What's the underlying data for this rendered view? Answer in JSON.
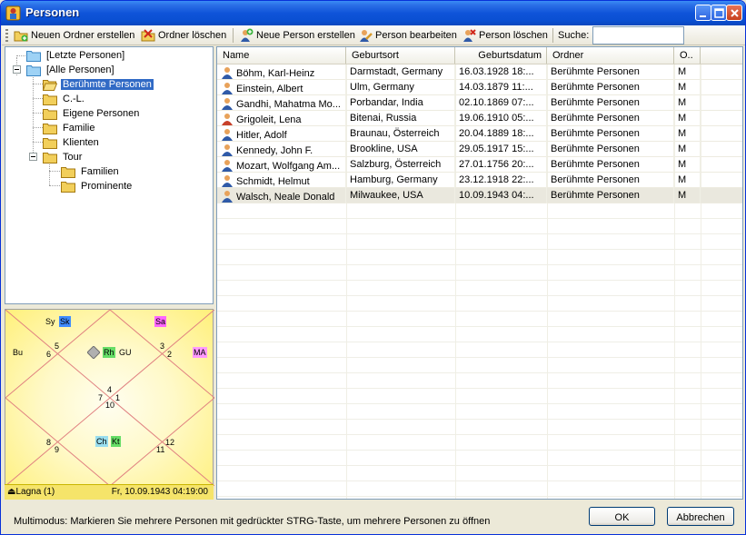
{
  "window": {
    "title": "Personen"
  },
  "toolbar": {
    "new_folder": "Neuen Ordner erstellen",
    "delete_folder": "Ordner löschen",
    "new_person": "Neue Person erstellen",
    "edit_person": "Person bearbeiten",
    "delete_person": "Person löschen",
    "search_label": "Suche:",
    "search_value": ""
  },
  "tree": {
    "items": [
      {
        "label": "[Letzte Personen]"
      },
      {
        "label": "[Alle Personen]"
      },
      {
        "label": "Berühmte Personen"
      },
      {
        "label": "C.-L."
      },
      {
        "label": "Eigene Personen"
      },
      {
        "label": "Familie"
      },
      {
        "label": "Klienten"
      },
      {
        "label": "Tour"
      },
      {
        "label": "Familien"
      },
      {
        "label": "Prominente"
      }
    ]
  },
  "chart": {
    "planets": {
      "sy": "Sy",
      "sk": "Sk",
      "sa": "Sa",
      "bu": "Bu",
      "ma": "MA",
      "rh": "Rh",
      "gu": "GU",
      "ch": "Ch",
      "kt": "Kt"
    },
    "houses": [
      "1",
      "2",
      "3",
      "4",
      "5",
      "6",
      "7",
      "8",
      "9",
      "10",
      "11",
      "12"
    ],
    "footer_left": "Lagna (1)",
    "footer_right": "Fr, 10.09.1943 04:19:00",
    "colors": {
      "sk": "#3f8cff",
      "sa": "#ff66ff",
      "ma": "#ff99ff",
      "rh": "#66dd66",
      "ch": "#99ddee",
      "kt": "#66dd66"
    }
  },
  "list": {
    "columns": [
      "Name",
      "Geburtsort",
      "Geburtsdatum",
      "Ordner",
      "O.."
    ],
    "rows": [
      {
        "name": "Böhm, Karl-Heinz",
        "place": "Darmstadt, Germany",
        "date": "16.03.1928 18:...",
        "folder": "Berühmte Personen",
        "o": "M",
        "gender": "m"
      },
      {
        "name": "Einstein, Albert",
        "place": "Ulm, Germany",
        "date": "14.03.1879 11:...",
        "folder": "Berühmte Personen",
        "o": "M",
        "gender": "m"
      },
      {
        "name": "Gandhi, Mahatma Mo...",
        "place": "Porbandar, India",
        "date": "02.10.1869 07:...",
        "folder": "Berühmte Personen",
        "o": "M",
        "gender": "m"
      },
      {
        "name": "Grigoleit, Lena",
        "place": "Bitenai, Russia",
        "date": "19.06.1910 05:...",
        "folder": "Berühmte Personen",
        "o": "M",
        "gender": "f"
      },
      {
        "name": "Hitler, Adolf",
        "place": "Braunau, Österreich",
        "date": "20.04.1889 18:...",
        "folder": "Berühmte Personen",
        "o": "M",
        "gender": "m"
      },
      {
        "name": "Kennedy, John F.",
        "place": "Brookline, USA",
        "date": "29.05.1917 15:...",
        "folder": "Berühmte Personen",
        "o": "M",
        "gender": "m"
      },
      {
        "name": "Mozart, Wolfgang Am...",
        "place": "Salzburg, Österreich",
        "date": "27.01.1756 20:...",
        "folder": "Berühmte Personen",
        "o": "M",
        "gender": "m"
      },
      {
        "name": "Schmidt, Helmut",
        "place": "Hamburg, Germany",
        "date": "23.12.1918 22:...",
        "folder": "Berühmte Personen",
        "o": "M",
        "gender": "m"
      },
      {
        "name": "Walsch, Neale Donald",
        "place": "Milwaukee, USA",
        "date": "10.09.1943 04:...",
        "folder": "Berühmte Personen",
        "o": "M",
        "gender": "m",
        "selected": true
      }
    ]
  },
  "status": {
    "text": "Multimodus: Markieren Sie mehrere Personen mit gedrückter STRG-Taste, um mehrere Personen zu öffnen",
    "ok": "OK",
    "cancel": "Abbrechen"
  }
}
